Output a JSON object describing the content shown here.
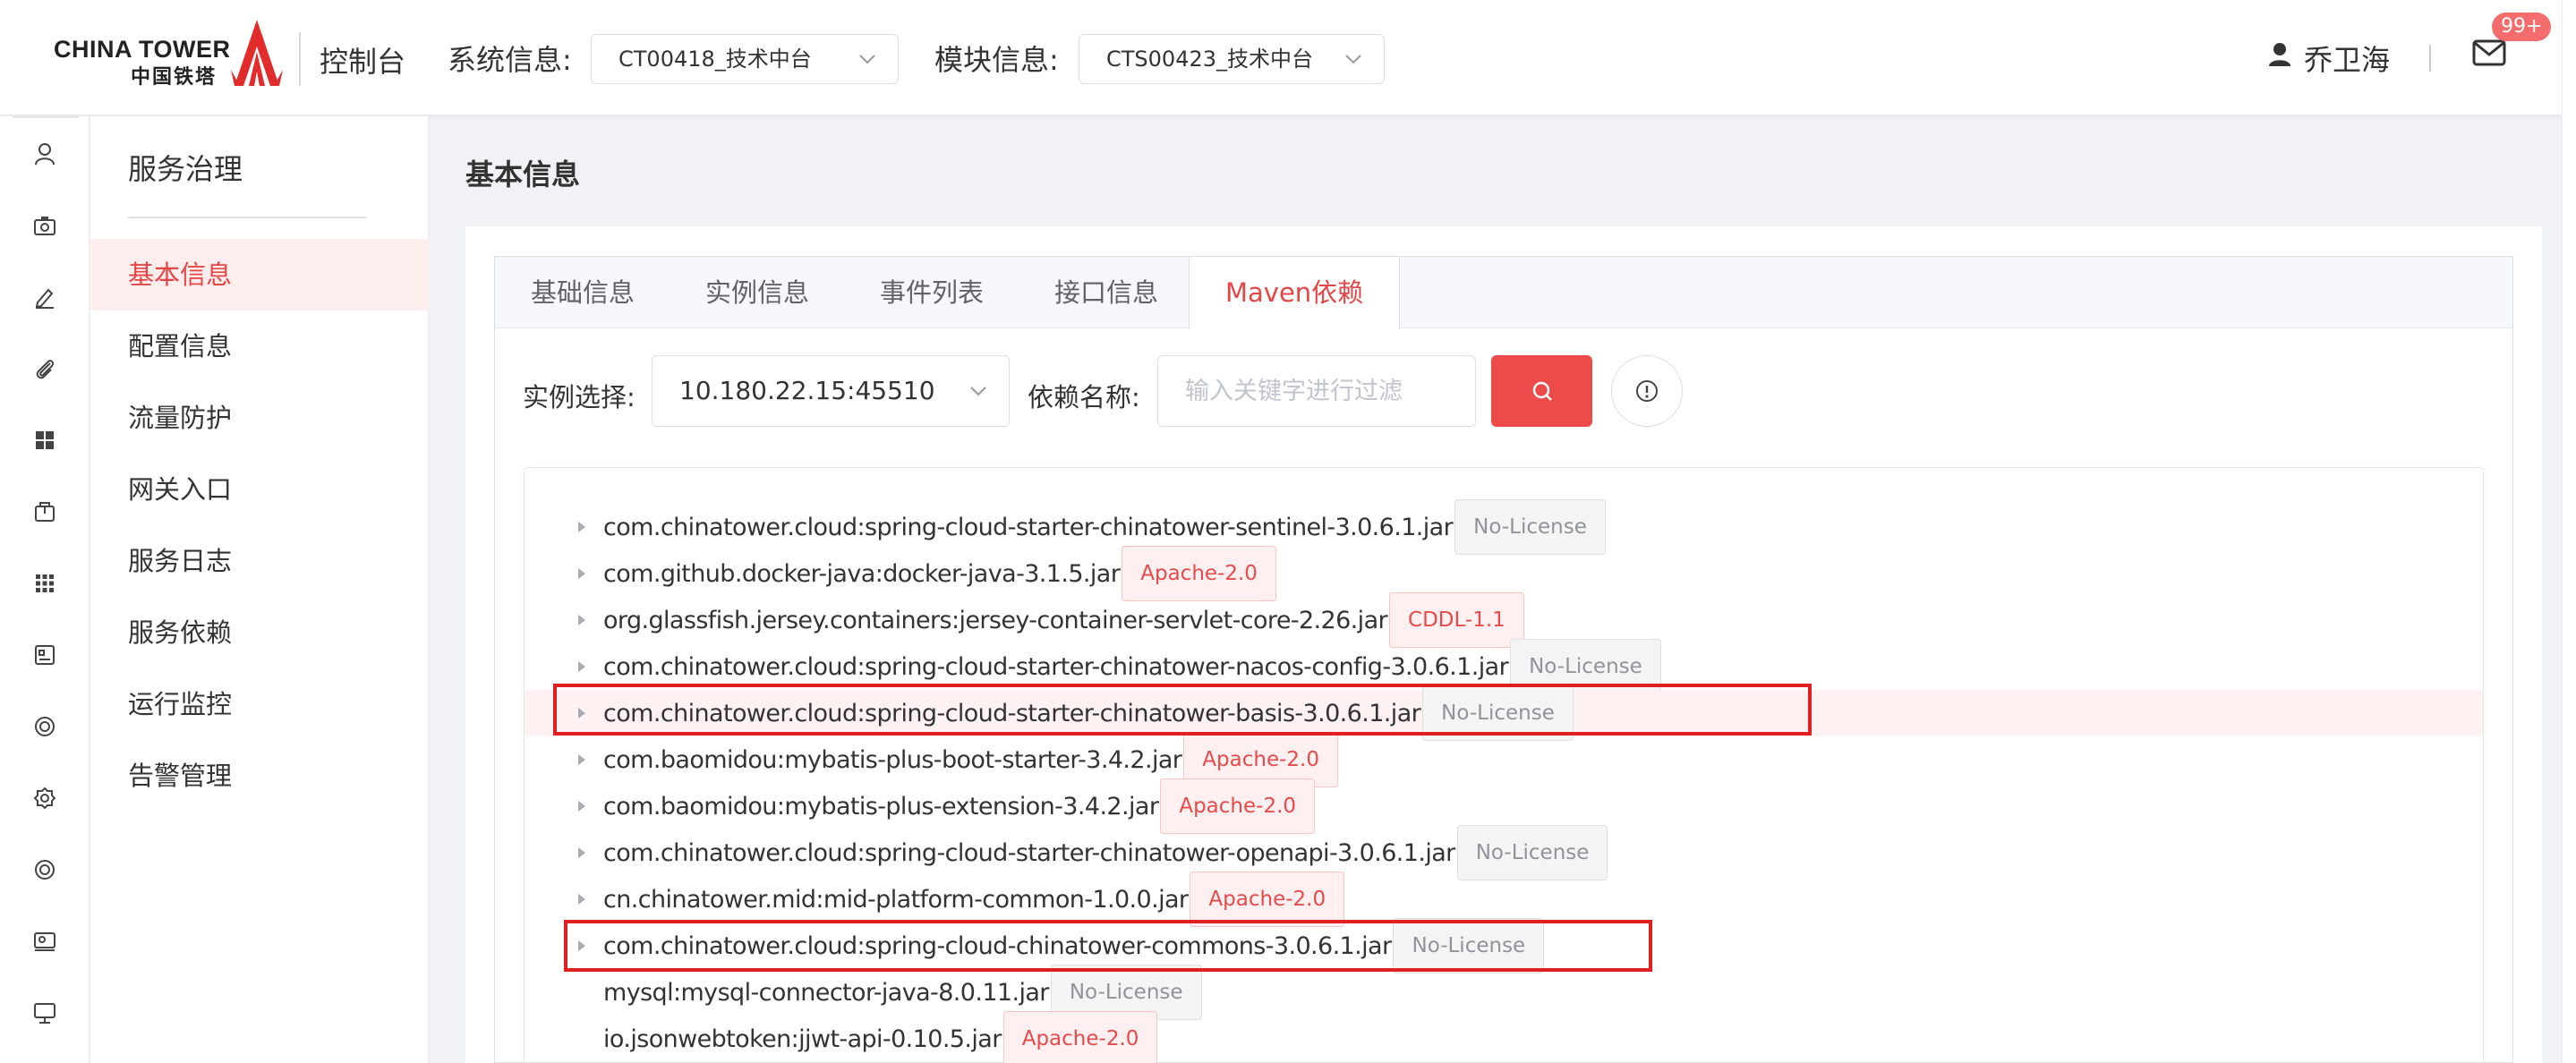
{
  "header": {
    "logo_en": "CHINA TOWER",
    "logo_cn": "中国铁塔",
    "console_label": "控制台",
    "system_label": "系统信息:",
    "system_value": "CT00418_技术中台",
    "module_label": "模块信息:",
    "module_value": "CTS00423_技术中台",
    "user_name": "乔卫海",
    "mail_badge": "99+"
  },
  "rail_icons": [
    "user-icon",
    "camera-icon",
    "edit-icon",
    "paperclip-icon",
    "grid-icon",
    "package-icon",
    "apps-icon",
    "id-card-icon",
    "lifebuoy-icon",
    "settings-icon",
    "lifebuoy-icon",
    "photo-icon",
    "monitor-icon"
  ],
  "subnav": {
    "title": "服务治理",
    "items": [
      "基本信息",
      "配置信息",
      "流量防护",
      "网关入口",
      "服务日志",
      "服务依赖",
      "运行监控",
      "告警管理"
    ],
    "active_index": 0
  },
  "page_title": "基本信息",
  "tabs": {
    "items": [
      "基础信息",
      "实例信息",
      "事件列表",
      "接口信息",
      "Maven依赖"
    ],
    "active_index": 4
  },
  "filter": {
    "instance_label": "实例选择:",
    "instance_value": "10.180.22.15:45510",
    "dep_label": "依赖名称:",
    "dep_placeholder": "输入关键字进行过滤"
  },
  "dependencies": [
    {
      "name": "com.chinatower.cloud:spring-cloud-starter-chinatower-sentinel-3.0.6.1.jar",
      "license": "No-License"
    },
    {
      "name": "com.github.docker-java:docker-java-3.1.5.jar",
      "license": "Apache-2.0"
    },
    {
      "name": "org.glassfish.jersey.containers:jersey-container-servlet-core-2.26.jar",
      "license": "CDDL-1.1"
    },
    {
      "name": "com.chinatower.cloud:spring-cloud-starter-chinatower-nacos-config-3.0.6.1.jar",
      "license": "No-License"
    },
    {
      "name": "com.chinatower.cloud:spring-cloud-starter-chinatower-basis-3.0.6.1.jar",
      "license": "No-License"
    },
    {
      "name": "com.baomidou:mybatis-plus-boot-starter-3.4.2.jar",
      "license": "Apache-2.0"
    },
    {
      "name": "com.baomidou:mybatis-plus-extension-3.4.2.jar",
      "license": "Apache-2.0"
    },
    {
      "name": "com.chinatower.cloud:spring-cloud-starter-chinatower-openapi-3.0.6.1.jar",
      "license": "No-License"
    },
    {
      "name": "cn.chinatower.mid:mid-platform-common-1.0.0.jar",
      "license": "Apache-2.0"
    },
    {
      "name": "com.chinatower.cloud:spring-cloud-chinatower-commons-3.0.6.1.jar",
      "license": "No-License"
    },
    {
      "name": "mysql:mysql-connector-java-8.0.11.jar",
      "license": "No-License"
    },
    {
      "name": "io.jsonwebtoken:jjwt-api-0.10.5.jar",
      "license": "Apache-2.0"
    }
  ],
  "colors": {
    "accent": "#e64545",
    "badge": "#f56c6c",
    "highlight_box": "#e02020"
  }
}
